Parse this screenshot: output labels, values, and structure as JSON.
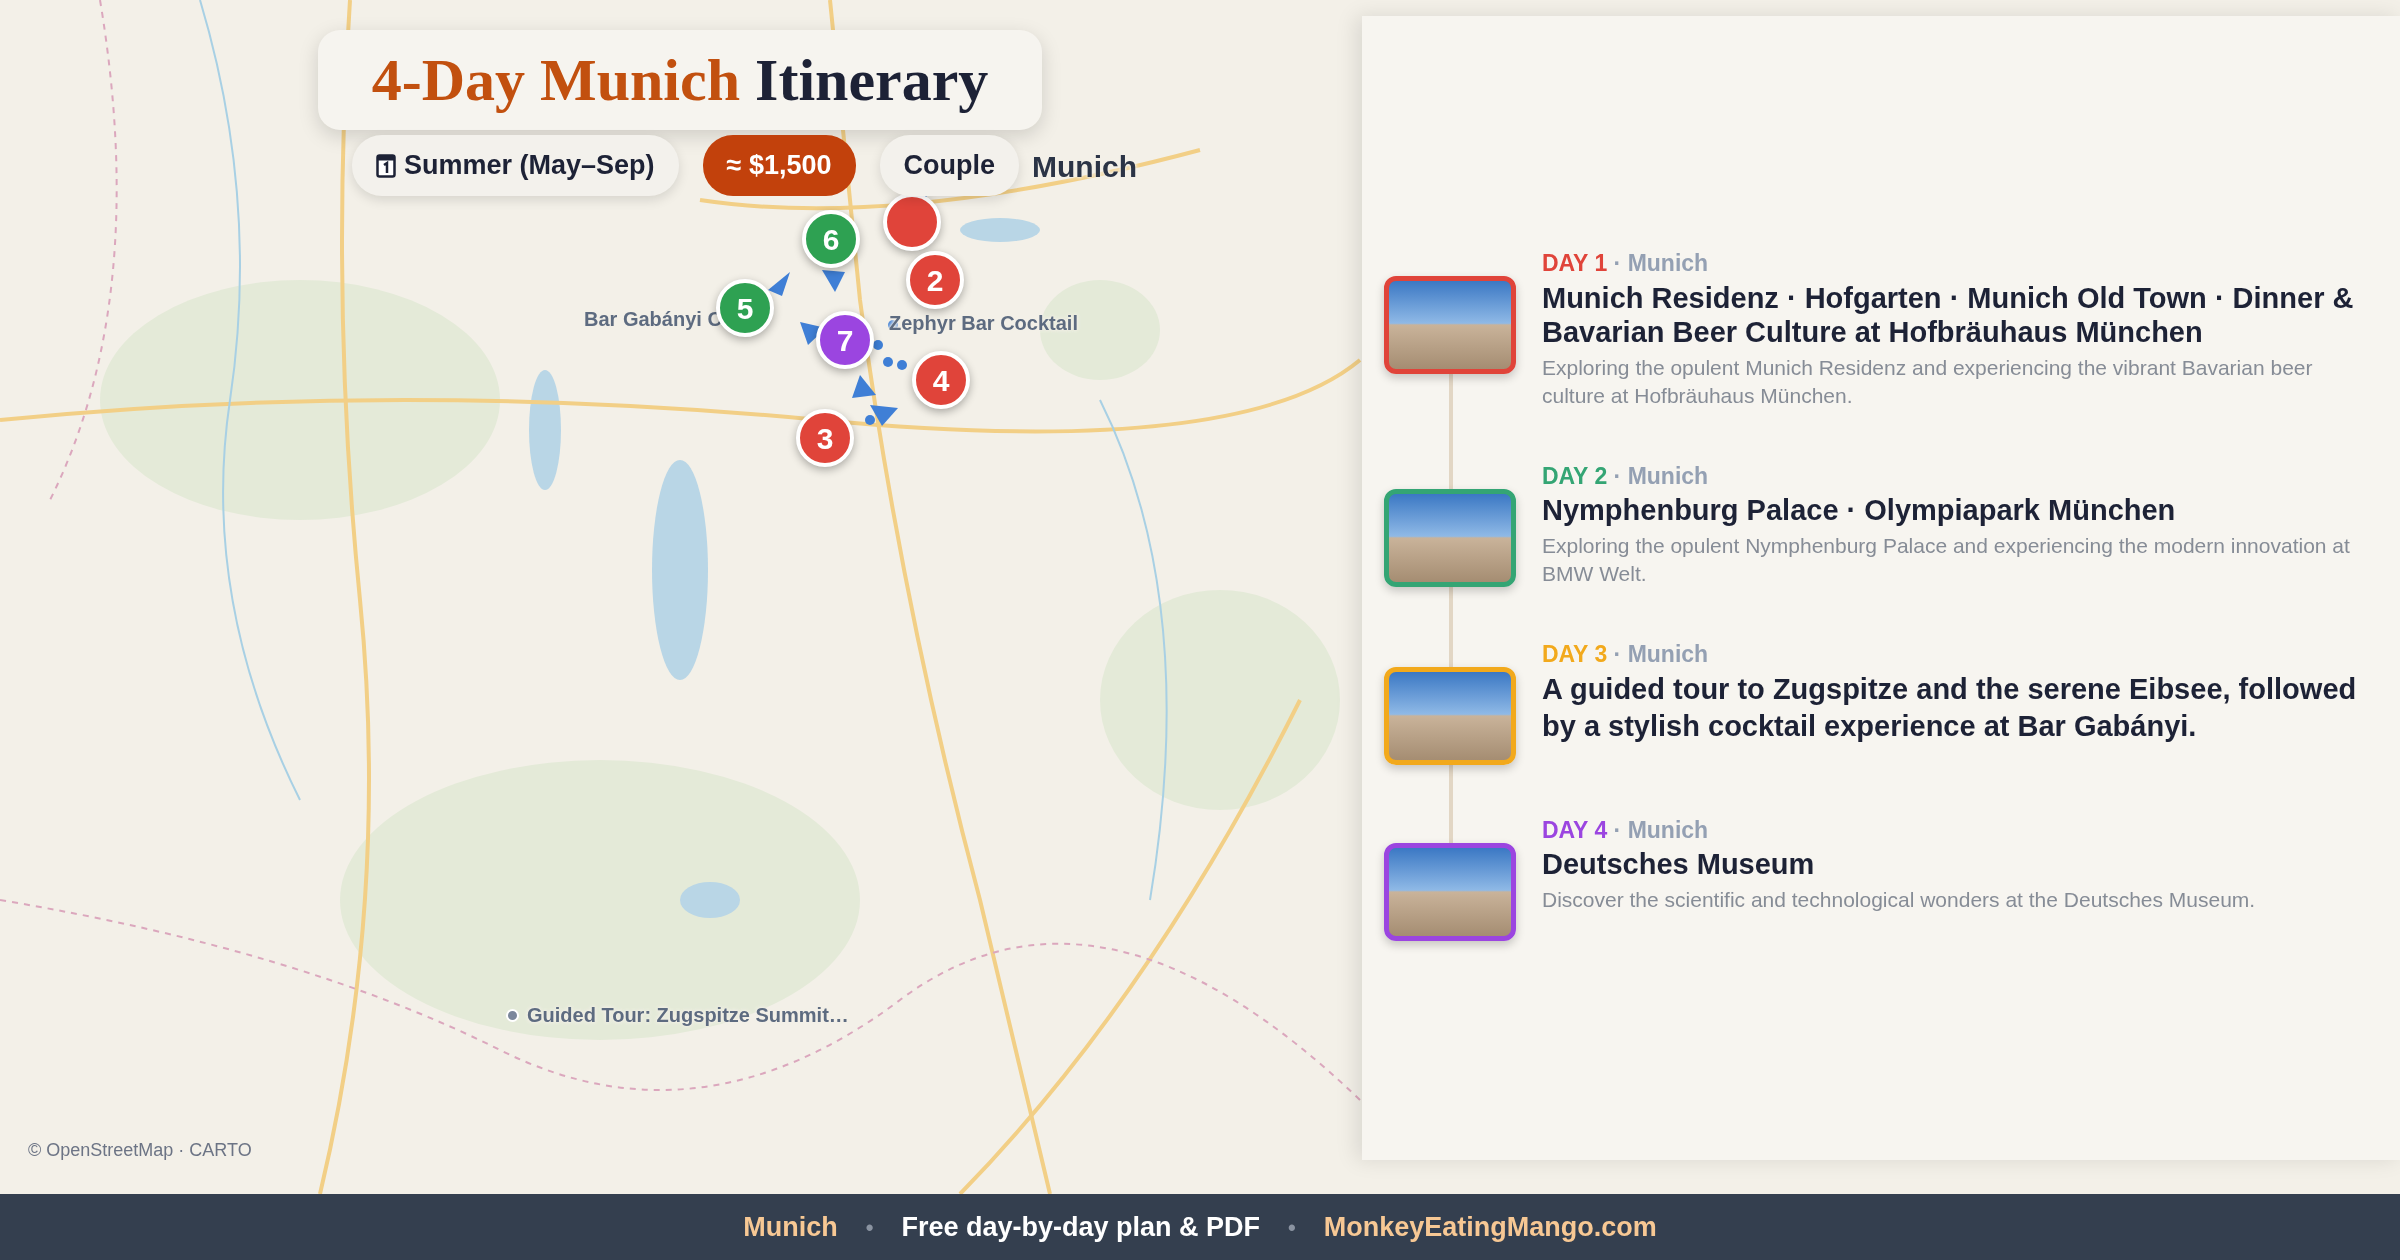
{
  "title": {
    "highlight": "4-Day Munich",
    "rest": "Itinerary"
  },
  "chips": [
    {
      "kind": "season",
      "text": "Summer (May–Sep)"
    },
    {
      "kind": "price",
      "text": "≈ $1,500"
    },
    {
      "kind": "plain",
      "text": "Couple"
    }
  ],
  "map": {
    "labels": [
      {
        "kind": "city",
        "text": "Munich"
      },
      {
        "kind": "place",
        "text": "Bar Gabányi C"
      },
      {
        "kind": "place",
        "text": "Zephyr Bar Cocktail"
      },
      {
        "kind": "dot",
        "text": "Guided Tour: Zugspitze Summit…"
      }
    ],
    "markers": [
      {
        "color": "#e0443a"
      },
      {
        "label": "2",
        "color": "#e0443a"
      },
      {
        "label": "3",
        "color": "#e0443a"
      },
      {
        "label": "4",
        "color": "#e0443a"
      },
      {
        "label": "5",
        "color": "#2ea152"
      },
      {
        "label": "6",
        "color": "#2ea152"
      },
      {
        "label": "7",
        "color": "#9b45e0"
      }
    ],
    "attribution": "© OpenStreetMap · CARTO"
  },
  "days": [
    {
      "day": "DAY 1",
      "city": "· Munich",
      "color": "#e0443a",
      "title": "Munich Residenz · Hofgarten · Munich Old Town · Dinner & Bavarian Beer Culture at Hofbräuhaus München",
      "description": "Exploring the opulent Munich Residenz and experiencing the vibrant Bavarian beer culture at Hofbräuhaus München."
    },
    {
      "day": "DAY 2",
      "city": "· Munich",
      "color": "#34a574",
      "title": "Nymphenburg Palace · Olympiapark München",
      "description": "Exploring the opulent Nymphenburg Palace and experiencing the modern innovation at BMW Welt."
    },
    {
      "day": "DAY 3",
      "city": "· Munich",
      "color": "#f2a91c",
      "title": "A guided tour to Zugspitze and the serene Eibsee, followed by a stylish cocktail experience at Bar Gabányi."
    },
    {
      "day": "DAY 4",
      "city": "· Munich",
      "color": "#9b45e0",
      "title": "Deutsches Museum",
      "description": "Discover the scientific and technological wonders at the Deutsches Museum."
    }
  ],
  "footer": [
    {
      "kind": "accent",
      "text": "Munich"
    },
    {
      "kind": "separator",
      "text": "•"
    },
    {
      "kind": "plain",
      "text": "Free day-by-day plan & PDF"
    },
    {
      "kind": "separator",
      "text": "•"
    },
    {
      "kind": "accent",
      "text": "MonkeyEatingMango.com"
    }
  ]
}
